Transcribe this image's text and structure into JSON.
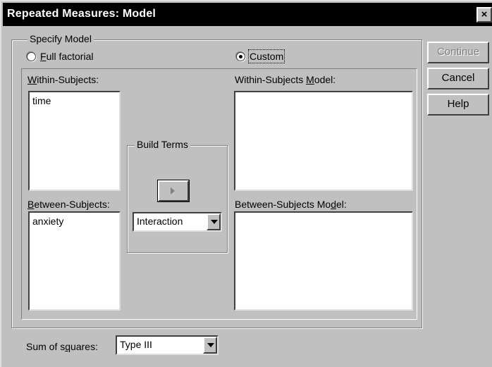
{
  "window": {
    "title": "Repeated Measures: Model",
    "close_label": "×"
  },
  "specify_model": {
    "legend": "Specify Model",
    "full_factorial": {
      "label": "Full factorial",
      "mnemonic": "F",
      "rest": "ull factorial",
      "selected": false
    },
    "custom": {
      "label": "Custom",
      "selected": true
    }
  },
  "within_subjects": {
    "label_mn": "W",
    "label_rest": "ithin-Subjects:",
    "items": [
      "time"
    ]
  },
  "between_subjects": {
    "label_mn": "B",
    "label_rest": "etween-Subjects:",
    "items": [
      "anxiety"
    ]
  },
  "within_model": {
    "label_pre": "Within-Subjects ",
    "label_mn": "M",
    "label_post": "odel:"
  },
  "between_model": {
    "label_pre": "Between-Subjects Mo",
    "label_mn": "d",
    "label_post": "el:"
  },
  "build_terms": {
    "legend": "Build Terms",
    "type_value": "Interaction"
  },
  "buttons": {
    "continue": "Continue",
    "cancel": "Cancel",
    "help": "Help"
  },
  "sum_of_squares": {
    "label_pre": "Sum of s",
    "label_mn": "q",
    "label_post": "uares:",
    "value": "Type III"
  }
}
